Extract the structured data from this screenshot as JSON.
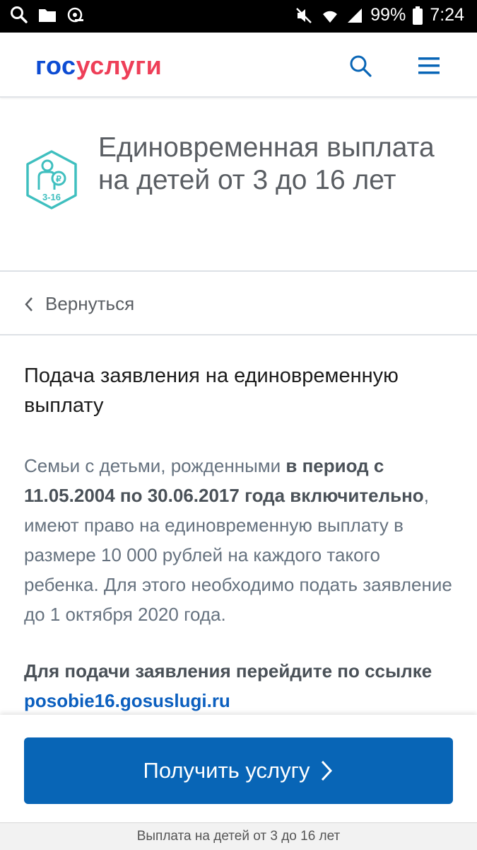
{
  "status_bar": {
    "battery": "99%",
    "time": "7:24",
    "icons": [
      "search-icon",
      "folder-icon",
      "voicemail-icon",
      "mute-icon",
      "wifi-icon",
      "signal-icon",
      "battery-icon"
    ]
  },
  "header": {
    "logo_part1": "гос",
    "logo_part2": "услуги",
    "icons": [
      "search-icon",
      "menu-icon"
    ],
    "colors": {
      "brand_blue": "#0d4cd3",
      "brand_red": "#ee3f58",
      "accent": "#0865b6"
    }
  },
  "service": {
    "icon_label": "3-16",
    "title": "Единовременная выплата на детей от 3 до 16 лет"
  },
  "back": {
    "label": "Вернуться"
  },
  "content": {
    "title": "Подача заявления на единовременную выплату",
    "p_text1": "Семьи с детьми, рожденными ",
    "p_bold": "в период с 11.05.2004 по 30.06.2017 года включительно",
    "p_text2": ", имеют право на единовременную выплату в размере 10 000 рублей на каждого такого ребенка. Для этого необходимо подать заявление до 1 октября 2020 года.",
    "link_lead": "Для подачи заявления перейдите по ссылке",
    "link_text": "posobie16.gosuslugi.ru"
  },
  "cta": {
    "label": "Получить услугу"
  },
  "footer": {
    "tab_title": "Выплата на детей от 3 до 16 лет"
  }
}
